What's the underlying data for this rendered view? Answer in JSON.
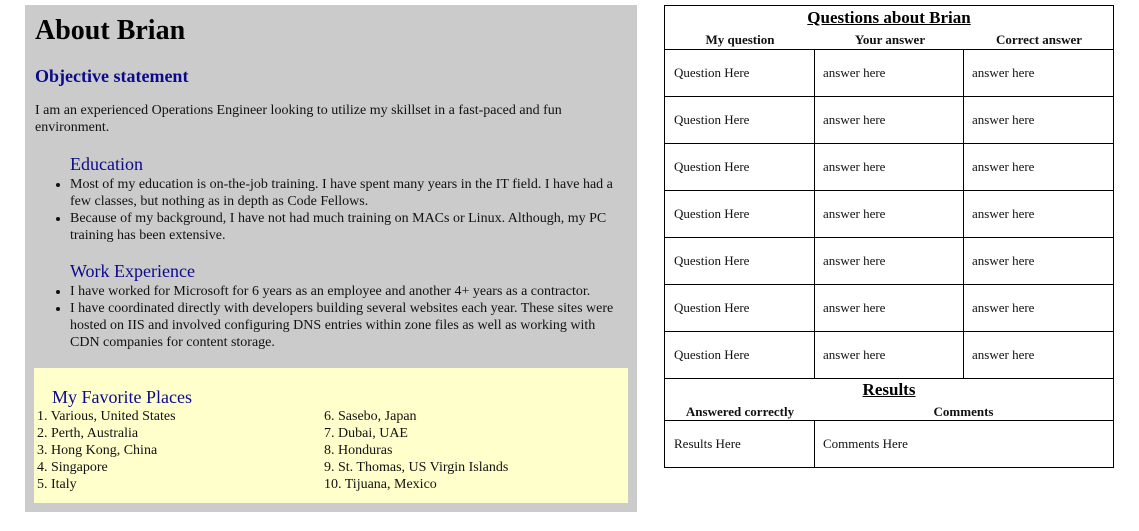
{
  "about": {
    "title": "About Brian",
    "objective_heading": "Objective statement",
    "objective_text": "I am an experienced Operations Engineer looking to utilize my skillset in a fast-paced and fun environment.",
    "education": {
      "heading": "Education",
      "items": [
        "Most of my education is on-the-job training. I have spent many years in the IT field. I have had a few classes, but nothing as in depth as Code Fellows.",
        "Because of my background, I have not had much training on MACs or Linux. Although, my PC training has been extensive."
      ]
    },
    "work": {
      "heading": "Work Experience",
      "items": [
        "I have worked for Microsoft for 6 years as an employee and another 4+ years as a contractor.",
        "I have coordinated directly with developers building several websites each year. These sites were hosted on IIS and involved configuring DNS entries within zone files as well as working with CDN companies for content storage."
      ]
    },
    "favorites": {
      "heading": "My Favorite Places",
      "col1": [
        "1. Various, United States",
        "2. Perth, Australia",
        "3. Hong Kong, China",
        "4. Singapore",
        "5. Italy"
      ],
      "col2": [
        "6. Sasebo, Japan",
        "7. Dubai, UAE",
        "8. Honduras",
        "9. St. Thomas, US Virgin Islands",
        "10. Tijuana, Mexico"
      ]
    },
    "colors": {
      "panel_bg": "#cbcbcb",
      "favorites_bg": "#ffffcc",
      "heading_blue": "#0a0a8a"
    }
  },
  "quiz": {
    "title": "Questions about Brian",
    "headers": [
      "My question",
      "Your answer",
      "Correct answer"
    ],
    "rows": [
      [
        "Question Here",
        "answer here",
        "answer here"
      ],
      [
        "Question Here",
        "answer here",
        "answer here"
      ],
      [
        "Question Here",
        "answer here",
        "answer here"
      ],
      [
        "Question Here",
        "answer here",
        "answer here"
      ],
      [
        "Question Here",
        "answer here",
        "answer here"
      ],
      [
        "Question Here",
        "answer here",
        "answer here"
      ],
      [
        "Question Here",
        "answer here",
        "answer here"
      ]
    ],
    "results_title": "Results",
    "results_headers": [
      "Answered correctly",
      "Comments"
    ],
    "results_row": [
      "Results Here",
      "Comments Here"
    ]
  }
}
